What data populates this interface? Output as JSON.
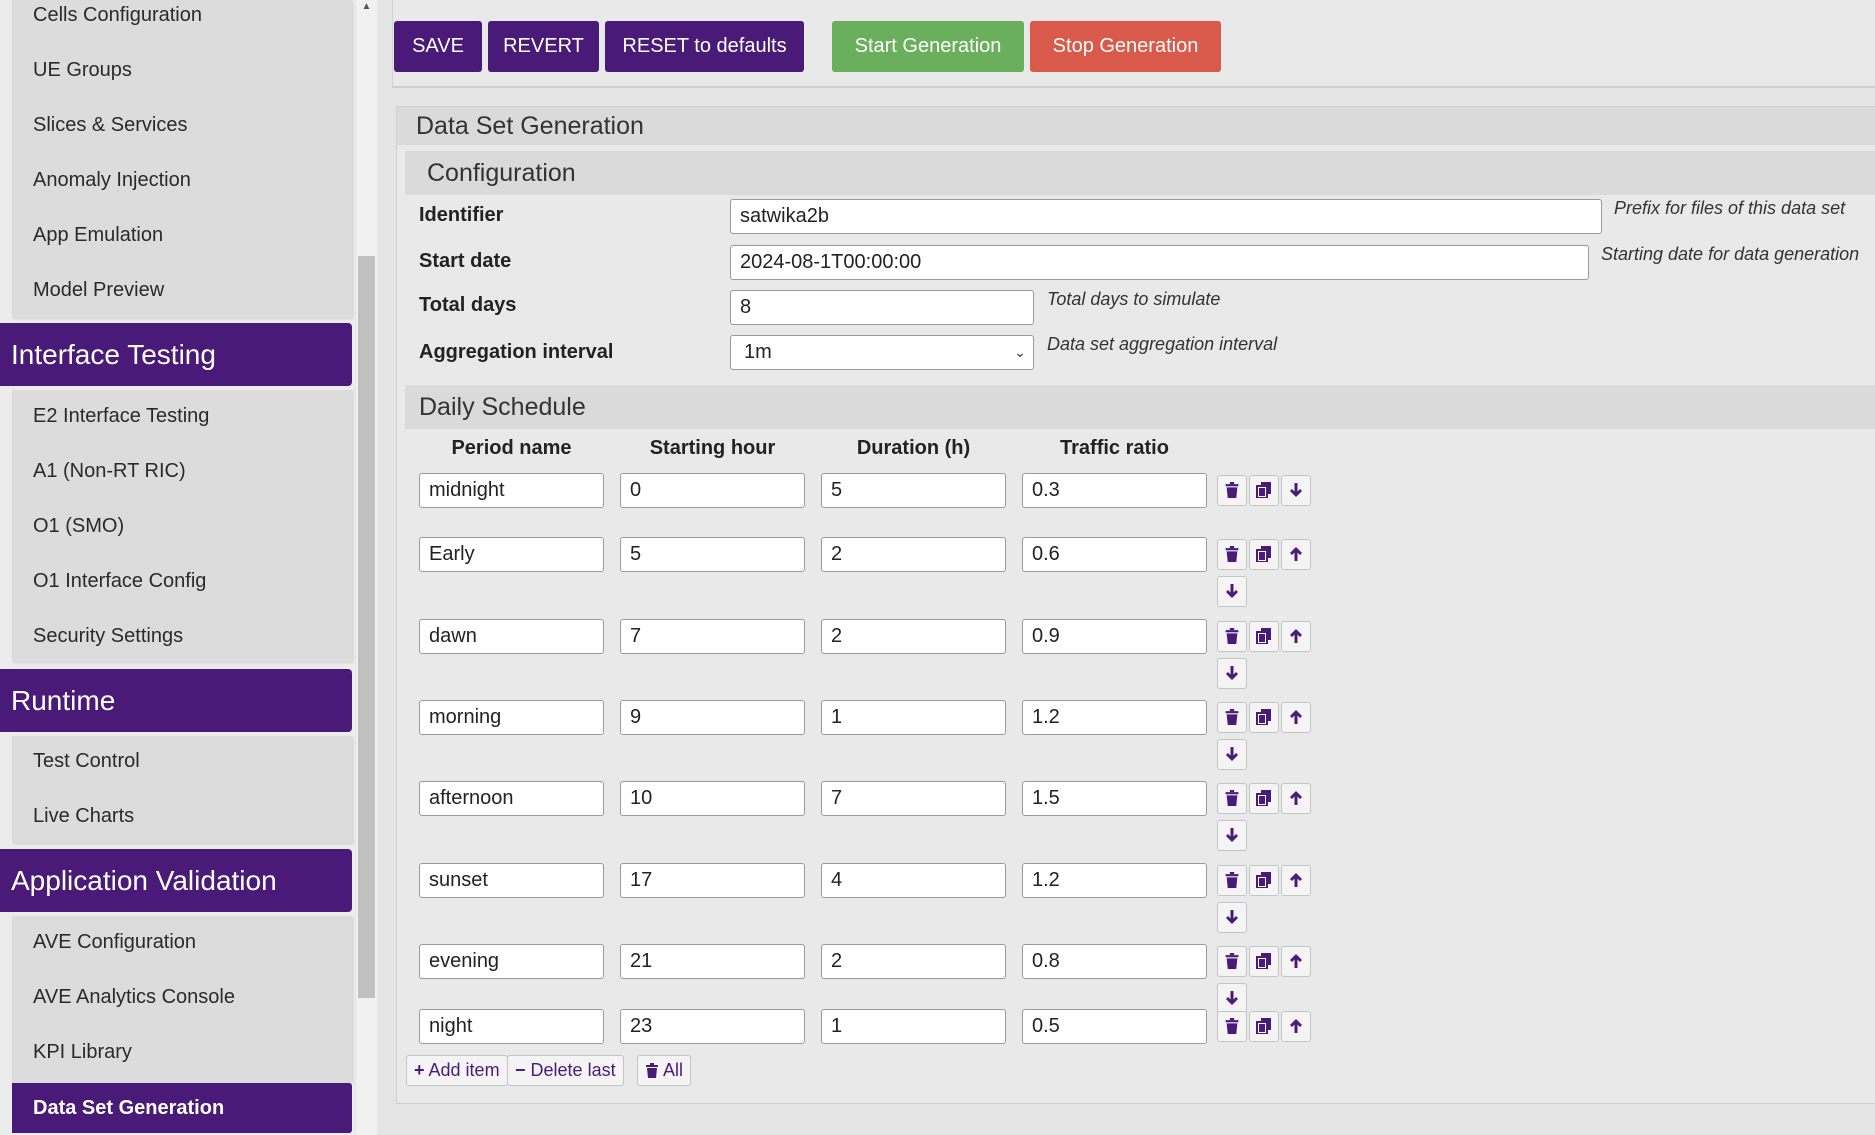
{
  "sidebar": {
    "group1_items": [
      "Cells Configuration",
      "UE Groups",
      "Slices & Services",
      "Anomaly Injection",
      "App Emulation",
      "Model Preview"
    ],
    "sections": [
      {
        "title": "Interface Testing",
        "items": [
          "E2 Interface Testing",
          "A1 (Non-RT RIC)",
          "O1 (SMO)",
          "O1 Interface Config",
          "Security Settings"
        ]
      },
      {
        "title": "Runtime",
        "items": [
          "Test Control",
          "Live Charts"
        ]
      },
      {
        "title": "Application Validation",
        "items": [
          "AVE Configuration",
          "AVE Analytics Console",
          "KPI Library"
        ]
      }
    ],
    "active_item": "Data Set Generation"
  },
  "toolbar": {
    "save": "SAVE",
    "revert": "REVERT",
    "reset": "RESET to defaults",
    "start": "Start Generation",
    "stop": "Stop Generation"
  },
  "panel": {
    "title": "Data Set Generation",
    "configuration": {
      "title": "Configuration",
      "identifier": {
        "label": "Identifier",
        "value": "satwika2b",
        "hint": "Prefix for files of this data set"
      },
      "start_date": {
        "label": "Start date",
        "value": "2024-08-1T00:00:00",
        "hint": "Starting date for data generation"
      },
      "total_days": {
        "label": "Total days",
        "value": "8",
        "hint": "Total days to simulate"
      },
      "aggregation": {
        "label": "Aggregation interval",
        "value": "1m",
        "hint": "Data set aggregation interval"
      }
    },
    "schedule": {
      "title": "Daily Schedule",
      "columns": [
        "Period name",
        "Starting hour",
        "Duration (h)",
        "Traffic ratio"
      ],
      "rows": [
        {
          "name": "midnight",
          "start": "0",
          "duration": "5",
          "ratio": "0.3"
        },
        {
          "name": "Early",
          "start": "5",
          "duration": "2",
          "ratio": "0.6"
        },
        {
          "name": "dawn",
          "start": "7",
          "duration": "2",
          "ratio": "0.9"
        },
        {
          "name": "morning",
          "start": "9",
          "duration": "1",
          "ratio": "1.2"
        },
        {
          "name": "afternoon",
          "start": "10",
          "duration": "7",
          "ratio": "1.5"
        },
        {
          "name": "sunset",
          "start": "17",
          "duration": "4",
          "ratio": "1.2"
        },
        {
          "name": "evening",
          "start": "21",
          "duration": "2",
          "ratio": "0.8"
        },
        {
          "name": "night",
          "start": "23",
          "duration": "1",
          "ratio": "0.5"
        }
      ],
      "add_item": "Add item",
      "delete_last": "Delete last",
      "delete_all": "All"
    }
  },
  "colors": {
    "accent": "#4a1a78",
    "start": "#6aaf5c",
    "stop": "#d9594a"
  },
  "icons": {
    "delete": "trash-icon",
    "copy": "copy-icon",
    "up": "arrow-up-icon",
    "down": "arrow-down-icon",
    "plus": "plus-icon",
    "minus": "minus-icon"
  }
}
